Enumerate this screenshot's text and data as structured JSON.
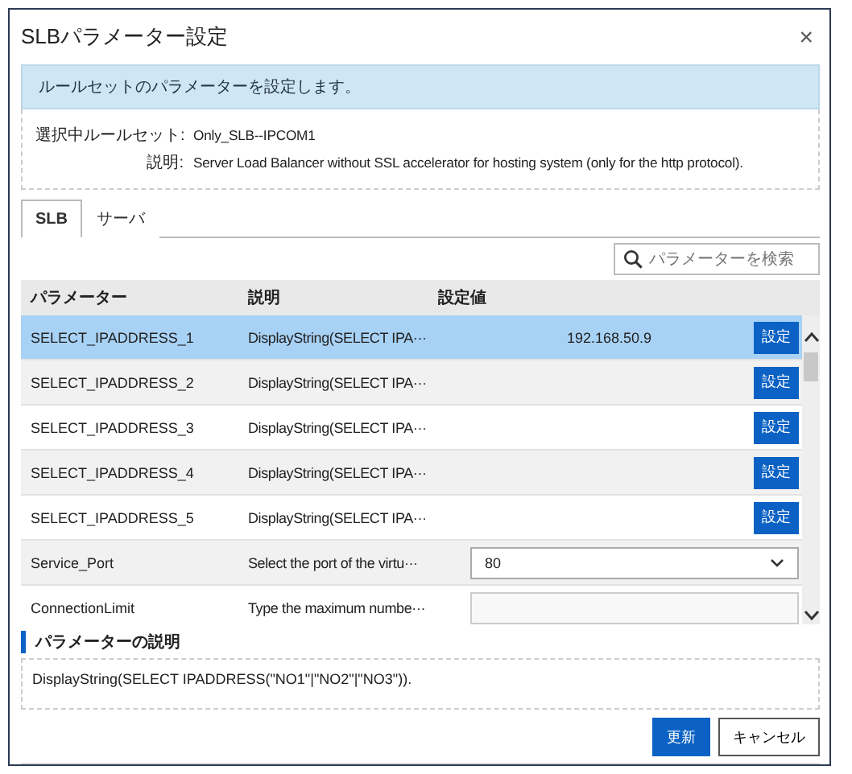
{
  "dialog": {
    "title": "SLBパラメーター設定",
    "close": "×"
  },
  "banner": "ルールセットのパラメーターを設定します。",
  "ruleset": [
    {
      "label": "選択中ルールセット:",
      "value": "Only_SLB--IPCOM1"
    },
    {
      "label": "説明:",
      "value": "Server Load Balancer without SSL accelerator for hosting system (only for the http protocol)."
    }
  ],
  "tabs": [
    {
      "label": "SLB",
      "selected": true
    },
    {
      "label": "サーバ",
      "selected": false
    }
  ],
  "search": {
    "placeholder": "パラメーターを検索"
  },
  "table": {
    "columns": [
      "パラメーター",
      "説明",
      "設定値"
    ],
    "rows": [
      {
        "kind": "setting",
        "name": "SELECT_IPADDRESS_1",
        "description": "DisplayString(SELECT IPA···",
        "value": "192.168.50.9",
        "button": "設定",
        "selected": true
      },
      {
        "kind": "setting",
        "name": "SELECT_IPADDRESS_2",
        "description": "DisplayString(SELECT IPA···",
        "button": "設定",
        "selected": false
      },
      {
        "kind": "setting",
        "name": "SELECT_IPADDRESS_3",
        "description": "DisplayString(SELECT IPA···",
        "button": "設定",
        "selected": false
      },
      {
        "kind": "setting",
        "name": "SELECT_IPADDRESS_4",
        "description": "DisplayString(SELECT IPA···",
        "button": "設定",
        "selected": false
      },
      {
        "kind": "setting",
        "name": "SELECT_IPADDRESS_5",
        "description": "DisplayString(SELECT IPA···",
        "button": "設定",
        "selected": false
      },
      {
        "kind": "select",
        "name": "Service_Port",
        "description": "Select the port of the virtu···",
        "value": "80",
        "selected": false
      },
      {
        "kind": "input",
        "name": "ConnectionLimit",
        "description": "Type the maximum numbe···",
        "selected": false
      }
    ]
  },
  "description_section": {
    "heading": "パラメーターの説明",
    "text": "DisplayString(SELECT IPADDRESS(\"NO1\"|\"NO2\"|\"NO3\"))."
  },
  "buttons": [
    {
      "label": "更新",
      "kind": "primary"
    },
    {
      "label": "キャンセル",
      "kind": "secondary"
    }
  ]
}
